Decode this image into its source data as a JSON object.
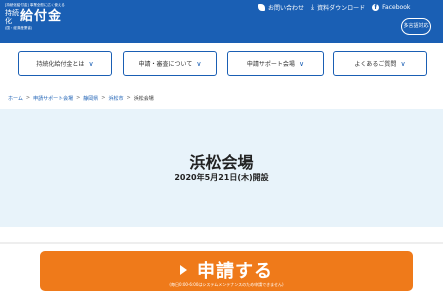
{
  "header": {
    "logo": {
      "tagline": "[持続化給付金] 事業全般に広く使える",
      "small": "持続化",
      "main": "給付金",
      "sub": "(国・経済産業省)"
    },
    "links": {
      "contact": "お問い合わせ",
      "download": "資料ダウンロード",
      "facebook": "Facebook"
    },
    "lang_button": "多言語対応"
  },
  "nav": {
    "items": [
      {
        "label": "持続化給付金とは"
      },
      {
        "label": "申請・審査について"
      },
      {
        "label": "申請サポート会場"
      },
      {
        "label": "よくあるご質問"
      }
    ]
  },
  "breadcrumb": [
    "ホーム",
    "申請サポート会場",
    "静岡県",
    "浜松市",
    "浜松会場"
  ],
  "hero": {
    "title": "浜松会場",
    "date": "2020年5月21日(木)開設"
  },
  "apply": {
    "label": "申請する",
    "note": "(毎日0:00-6:00はシステムメンテナンスのため申請できません)"
  },
  "colors": {
    "brand": "#1a5fb4",
    "hero_bg": "#e8f3fa",
    "apply": "#ef7a1a"
  }
}
